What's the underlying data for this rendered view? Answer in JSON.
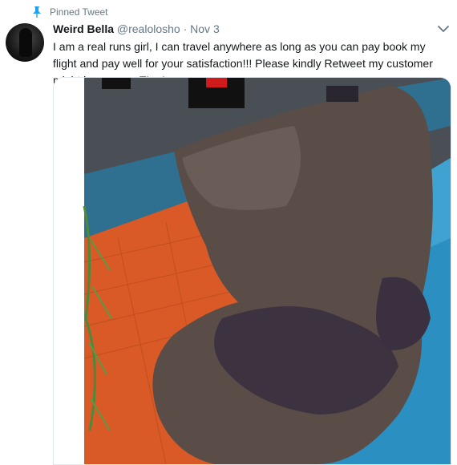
{
  "pinned": {
    "label": "Pinned Tweet",
    "icon": "pin-icon"
  },
  "author": {
    "display_name": "Weird Bella",
    "handle": "@realolosho",
    "separator": "·",
    "date": "Nov 3",
    "avatar_icon": "avatar"
  },
  "tweet": {
    "text": "I am a real runs girl, I can travel anywhere as long as you can pay book my flight and pay well for your satisfaction!!! Please kindly Retweet my customer might be on your TL...!"
  },
  "menu": {
    "icon": "chevron-down-icon"
  },
  "colors": {
    "text": "#14171a",
    "secondary": "#657786",
    "accent": "#1da1f2",
    "border": "#e1e8ed",
    "pool_water": "#3fa2d0",
    "pool_deck": "#e0632a"
  }
}
